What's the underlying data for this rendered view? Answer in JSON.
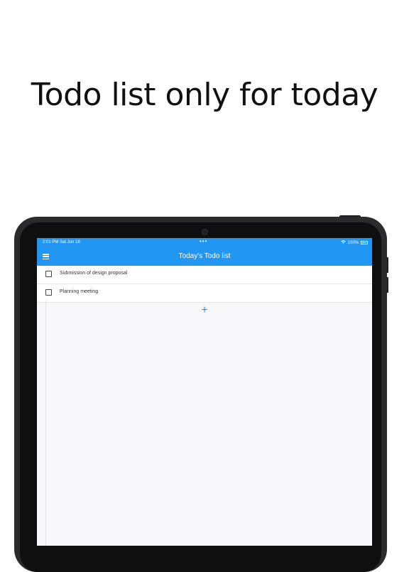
{
  "headline": "Todo list only for today",
  "status_bar": {
    "time": "2:01 PM  Sat Jun 18",
    "dots": "•••",
    "battery": "100%"
  },
  "app_bar": {
    "title": "Today's Todo list"
  },
  "todos": [
    {
      "label": "Submission of design proposal",
      "checked": false
    },
    {
      "label": "Planning meeting",
      "checked": false
    }
  ],
  "add_icon": "+",
  "colors": {
    "accent": "#2196f3",
    "frame": "#2b2b2d"
  }
}
